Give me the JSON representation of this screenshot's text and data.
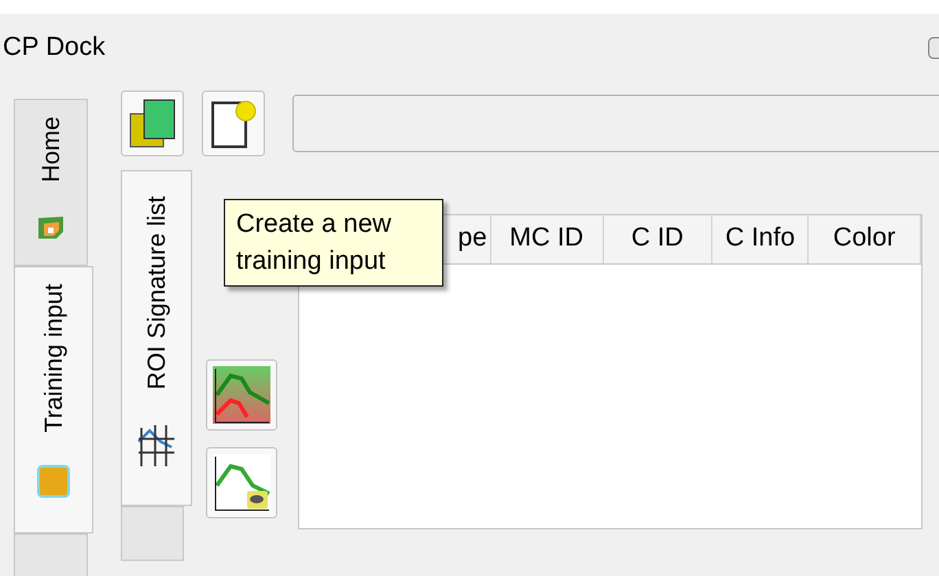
{
  "window": {
    "title": "CP Dock"
  },
  "main_tabs": [
    {
      "label": "Home",
      "selected": false,
      "kind": "map"
    },
    {
      "label": "Training input",
      "selected": true,
      "kind": "square"
    },
    {
      "selected": false,
      "kind": "blank"
    }
  ],
  "toolbar": {
    "buttons": [
      {
        "kind": "open"
      },
      {
        "kind": "new"
      }
    ]
  },
  "tooltip": {
    "text": "Create a new training input"
  },
  "sub_tabs": [
    {
      "label": "ROI Signature list",
      "selected": true
    },
    {
      "selected": false
    }
  ],
  "side_buttons": [
    {
      "kind": "plot"
    },
    {
      "kind": "signature"
    }
  ],
  "table": {
    "columns": [
      "pe",
      "MC ID",
      "C ID",
      "C Info",
      "Color"
    ]
  }
}
